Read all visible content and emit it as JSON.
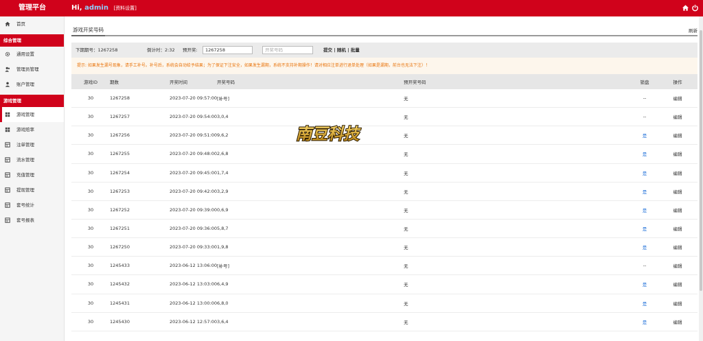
{
  "header": {
    "brand": "管理平台",
    "greeting": "Hi,",
    "username": "admin",
    "profile_link": "[资料设置]"
  },
  "sidebar": {
    "home": "首页",
    "section_general": "综合管理",
    "general_items": [
      "通用设置",
      "管理员管理",
      "账户管理"
    ],
    "section_game": "游戏管理",
    "game_items": [
      "游戏管理",
      "游戏赔率",
      "注单管理",
      "流水管理",
      "充值管理",
      "提现管理",
      "套号统计",
      "套号报表"
    ]
  },
  "main": {
    "tab": "游戏开奖号码",
    "refresh": "刷新",
    "toolbar": {
      "next_issue": "下期期号：1267258",
      "countdown": "倒计时：2:32",
      "preset_label": "预开奖:",
      "preset_value": "1267258",
      "number_placeholder": "开奖号码",
      "actions": "提交 | 随机 | 批量"
    },
    "tip": "提示: 如果发生漏号现象，请手工补号。补号后，系统会自动给予结果；为了保证下注安全，如果发生漏期，系统不支持补期操作！请对相应注单进行退单处理（如果是漏期，前台也无法下注）！",
    "columns": [
      "游戏ID",
      "期数",
      "开奖时间",
      "开奖号码",
      "预开奖号码",
      "锁盘",
      "操作"
    ],
    "rows": [
      {
        "id": "30",
        "issue": "1267258",
        "time": "2023-07-20 09:57:00",
        "number": "[补号]",
        "preset": "无",
        "lock": "--",
        "op": "编辑"
      },
      {
        "id": "30",
        "issue": "1267257",
        "time": "2023-07-20 09:54:00",
        "number": "3,0,4",
        "preset": "无",
        "lock": "--",
        "op": "编辑"
      },
      {
        "id": "30",
        "issue": "1267256",
        "time": "2023-07-20 09:51:00",
        "number": "9,6,2",
        "preset": "无",
        "lock": "是",
        "op": "编辑"
      },
      {
        "id": "30",
        "issue": "1267255",
        "time": "2023-07-20 09:48:00",
        "number": "2,6,8",
        "preset": "无",
        "lock": "是",
        "op": "编辑"
      },
      {
        "id": "30",
        "issue": "1267254",
        "time": "2023-07-20 09:45:00",
        "number": "1,7,4",
        "preset": "无",
        "lock": "是",
        "op": "编辑"
      },
      {
        "id": "30",
        "issue": "1267253",
        "time": "2023-07-20 09:42:00",
        "number": "3,2,9",
        "preset": "无",
        "lock": "是",
        "op": "编辑"
      },
      {
        "id": "30",
        "issue": "1267252",
        "time": "2023-07-20 09:39:00",
        "number": "0,6,9",
        "preset": "无",
        "lock": "是",
        "op": "编辑"
      },
      {
        "id": "30",
        "issue": "1267251",
        "time": "2023-07-20 09:36:00",
        "number": "5,8,7",
        "preset": "无",
        "lock": "是",
        "op": "编辑"
      },
      {
        "id": "30",
        "issue": "1267250",
        "time": "2023-07-20 09:33:00",
        "number": "1,9,8",
        "preset": "无",
        "lock": "是",
        "op": "编辑"
      },
      {
        "id": "30",
        "issue": "1245433",
        "time": "2023-06-12 13:06:00",
        "number": "[补号]",
        "preset": "无",
        "lock": "--",
        "op": "编辑"
      },
      {
        "id": "30",
        "issue": "1245432",
        "time": "2023-06-12 13:03:00",
        "number": "6,4,9",
        "preset": "无",
        "lock": "是",
        "op": "编辑"
      },
      {
        "id": "30",
        "issue": "1245431",
        "time": "2023-06-12 13:00:00",
        "number": "6,8,0",
        "preset": "无",
        "lock": "是",
        "op": "编辑"
      },
      {
        "id": "30",
        "issue": "1245430",
        "time": "2023-06-12 12:57:00",
        "number": "3,6,4",
        "preset": "无",
        "lock": "是",
        "op": "编辑"
      }
    ]
  },
  "watermark": {
    "text": "南豆科技"
  },
  "colors": {
    "brand_red": "#d0021b",
    "link_blue": "#1e6fd9",
    "tip_orange": "#e8730a"
  }
}
